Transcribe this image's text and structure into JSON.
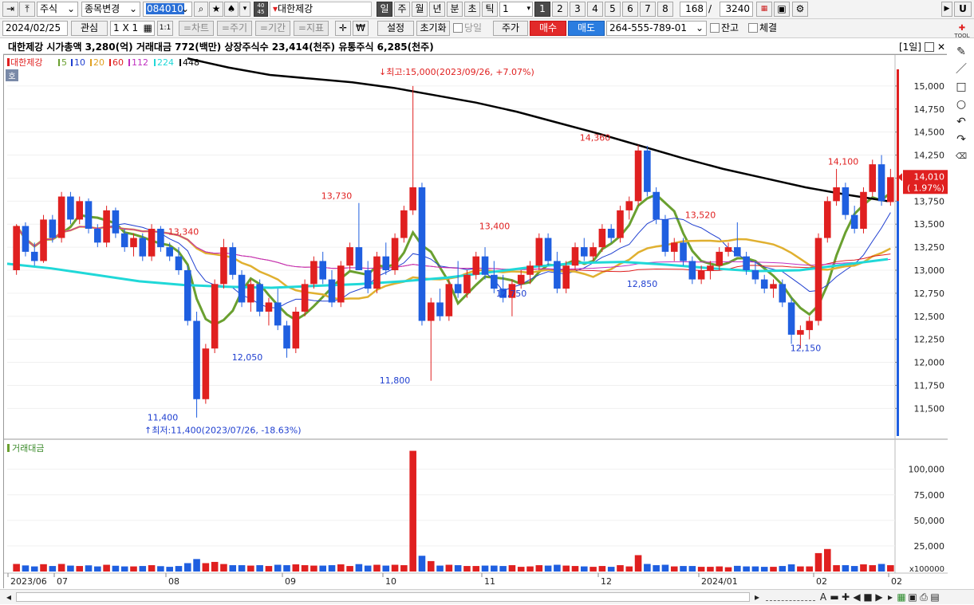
{
  "toolbar1": {
    "market": "주식",
    "change_stock": "종목변경",
    "code": "084010",
    "stock_name": "대한제강",
    "period_buttons": [
      "일",
      "주",
      "월",
      "년",
      "분",
      "초",
      "틱"
    ],
    "period_value": "1",
    "num_buttons": [
      "1",
      "2",
      "3",
      "4",
      "5",
      "6",
      "7",
      "8"
    ],
    "count_value": "168",
    "slash": "/",
    "count_total": "3240",
    "side_badge": "40\n45",
    "right_label": "U"
  },
  "toolbar2": {
    "date": "2024/02/25",
    "interest": "관심",
    "grid": "1 X 1",
    "one_one": "1:1",
    "chart": "=차트",
    "period": "=주기",
    "range": "=기간",
    "indicator": "=지표",
    "settings": "설정",
    "reset": "초기화",
    "today": "당일",
    "price": "주가",
    "buy": "매수",
    "sell": "매도",
    "account": "264-555-789-01",
    "balance": "잔고",
    "fill": "체결",
    "tool_label": "TOOL"
  },
  "infobar": {
    "text": "대한제강  시가총액 3,280(억)  거래대금 772(백만)  상장주식수 23,414(천주)  유통주식 6,285(천주)",
    "layout": "[1일]"
  },
  "price_panel": {
    "legend_name": "대한제강",
    "legend": [
      {
        "label": "5",
        "color": "#6aa030"
      },
      {
        "label": "10",
        "color": "#1f3fd0"
      },
      {
        "label": "20",
        "color": "#e0a020"
      },
      {
        "label": "60",
        "color": "#e02020"
      },
      {
        "label": "112",
        "color": "#c030c0"
      },
      {
        "label": "224",
        "color": "#20d8d8"
      },
      {
        "label": "448",
        "color": "#000000"
      }
    ],
    "ho_badge": "호",
    "y_ticks": [
      "15,000",
      "14,750",
      "14,500",
      "14,250",
      "14,000",
      "13,750",
      "13,500",
      "13,250",
      "13,000",
      "12,750",
      "12,500",
      "12,250",
      "12,000",
      "11,750",
      "11,500"
    ],
    "current_price": "14,010",
    "current_change": "( 1.97%)",
    "high_note": "최고:15,000(2023/09/26, +7.07%)",
    "low_note": "최저:11,400(2023/07/26, -18.63%)",
    "peak_labels": [
      {
        "text": "13,340",
        "color": "#e02020",
        "x": 225,
        "price": 13385
      },
      {
        "text": "13,730",
        "color": "#e02020",
        "x": 417,
        "price": 13775
      },
      {
        "text": "13,400",
        "color": "#e02020",
        "x": 615,
        "price": 13445
      },
      {
        "text": "14,360",
        "color": "#e02020",
        "x": 741,
        "price": 14405
      },
      {
        "text": "13,520",
        "color": "#e02020",
        "x": 873,
        "price": 13565
      },
      {
        "text": "14,100",
        "color": "#e02020",
        "x": 1052,
        "price": 14145
      }
    ],
    "trough_labels": [
      {
        "text": "11,400",
        "color": "#1f3fd0",
        "x": 199,
        "price": 11370
      },
      {
        "text": "12,050",
        "color": "#1f3fd0",
        "x": 305,
        "price": 12020
      },
      {
        "text": "11,800",
        "color": "#1f3fd0",
        "x": 490,
        "price": 11770
      },
      {
        "text": "12,750",
        "color": "#1f3fd0",
        "x": 636,
        "price": 12715
      },
      {
        "text": "12,850",
        "color": "#1f3fd0",
        "x": 800,
        "price": 12820
      },
      {
        "text": "12,150",
        "color": "#1f3fd0",
        "x": 1005,
        "price": 12120
      }
    ]
  },
  "volume_panel": {
    "title": "거래대금",
    "y_ticks": [
      "100,000",
      "75,000",
      "50,000",
      "25,000"
    ],
    "unit": "x100000"
  },
  "x_axis": {
    "labels": [
      "2023/06",
      "07",
      "08",
      "09",
      "10",
      "11",
      "12",
      "2024/01",
      "02",
      "02"
    ]
  },
  "chart_data": {
    "type": "candlestick",
    "title": "대한제강",
    "ylim": [
      11200,
      15250
    ],
    "candles_summary": {
      "high": 15000,
      "high_date": "2023/09/26",
      "low": 11400,
      "low_date": "2023/07/26",
      "last": 14010
    },
    "ohlc": [
      [
        13000,
        13500,
        12950,
        13480
      ],
      [
        13480,
        13520,
        13150,
        13200
      ],
      [
        13200,
        13300,
        13050,
        13100
      ],
      [
        13100,
        13600,
        13080,
        13550
      ],
      [
        13550,
        13600,
        13300,
        13350
      ],
      [
        13350,
        13850,
        13300,
        13800
      ],
      [
        13800,
        13850,
        13500,
        13550
      ],
      [
        13550,
        13800,
        13500,
        13750
      ],
      [
        13750,
        13780,
        13400,
        13450
      ],
      [
        13450,
        13500,
        13250,
        13300
      ],
      [
        13300,
        13700,
        13250,
        13650
      ],
      [
        13650,
        13680,
        13350,
        13400
      ],
      [
        13400,
        13450,
        13200,
        13250
      ],
      [
        13250,
        13400,
        13150,
        13350
      ],
      [
        13350,
        13400,
        13100,
        13150
      ],
      [
        13150,
        13500,
        13100,
        13450
      ],
      [
        13450,
        13480,
        13200,
        13250
      ],
      [
        13250,
        13300,
        13100,
        13150
      ],
      [
        13150,
        13250,
        12950,
        13000
      ],
      [
        13000,
        13050,
        12400,
        12450
      ],
      [
        12450,
        12550,
        11400,
        11600
      ],
      [
        11600,
        12200,
        11550,
        12150
      ],
      [
        12150,
        12900,
        12100,
        12850
      ],
      [
        12850,
        13340,
        12800,
        13250
      ],
      [
        13250,
        13300,
        12900,
        12950
      ],
      [
        12950,
        13000,
        12600,
        12650
      ],
      [
        12650,
        12900,
        12550,
        12850
      ],
      [
        12850,
        12900,
        12500,
        12550
      ],
      [
        12550,
        12700,
        12400,
        12650
      ],
      [
        12650,
        12800,
        12350,
        12400
      ],
      [
        12400,
        12450,
        12050,
        12150
      ],
      [
        12150,
        12600,
        12100,
        12550
      ],
      [
        12550,
        12900,
        12500,
        12850
      ],
      [
        12850,
        13150,
        12800,
        13100
      ],
      [
        13100,
        13200,
        12850,
        12900
      ],
      [
        12900,
        13000,
        12600,
        12650
      ],
      [
        12650,
        13100,
        12600,
        13050
      ],
      [
        13050,
        13300,
        13000,
        13250
      ],
      [
        13250,
        13730,
        13200,
        13000
      ],
      [
        13000,
        13100,
        12750,
        12800
      ],
      [
        12800,
        13200,
        12750,
        13150
      ],
      [
        13150,
        13300,
        12950,
        13000
      ],
      [
        13000,
        13400,
        12950,
        13350
      ],
      [
        13350,
        13700,
        13300,
        13650
      ],
      [
        13650,
        15000,
        13600,
        13900
      ],
      [
        13900,
        13950,
        12400,
        12450
      ],
      [
        12450,
        12700,
        11800,
        12650
      ],
      [
        12650,
        12800,
        12450,
        12500
      ],
      [
        12500,
        12900,
        12450,
        12850
      ],
      [
        12850,
        13100,
        12700,
        12750
      ],
      [
        12750,
        13000,
        12700,
        12950
      ],
      [
        12950,
        13200,
        12900,
        13150
      ],
      [
        13150,
        13250,
        12900,
        12950
      ],
      [
        12950,
        13100,
        12750,
        12800
      ],
      [
        12800,
        12950,
        12650,
        12700
      ],
      [
        12700,
        12900,
        12500,
        12850
      ],
      [
        12850,
        13000,
        12800,
        12950
      ],
      [
        12950,
        13100,
        12850,
        13050
      ],
      [
        13050,
        13400,
        13000,
        13350
      ],
      [
        13350,
        13400,
        13050,
        13100
      ],
      [
        13100,
        13200,
        12750,
        12800
      ],
      [
        12800,
        13100,
        12750,
        13050
      ],
      [
        13050,
        13300,
        13000,
        13250
      ],
      [
        13250,
        13350,
        13100,
        13150
      ],
      [
        13150,
        13300,
        13100,
        13250
      ],
      [
        13250,
        13500,
        13200,
        13450
      ],
      [
        13450,
        13500,
        13300,
        13350
      ],
      [
        13350,
        13700,
        13300,
        13650
      ],
      [
        13650,
        13800,
        13550,
        13750
      ],
      [
        13750,
        14360,
        13700,
        14300
      ],
      [
        14300,
        14350,
        13800,
        13850
      ],
      [
        13850,
        13900,
        13500,
        13550
      ],
      [
        13550,
        13600,
        13150,
        13200
      ],
      [
        13200,
        13350,
        13100,
        13300
      ],
      [
        13300,
        13350,
        13050,
        13100
      ],
      [
        13100,
        13150,
        12850,
        12900
      ],
      [
        12900,
        13050,
        12850,
        13000
      ],
      [
        13000,
        13100,
        12900,
        13050
      ],
      [
        13050,
        13250,
        13000,
        13200
      ],
      [
        13200,
        13300,
        13150,
        13250
      ],
      [
        13250,
        13520,
        13200,
        13150
      ],
      [
        13150,
        13200,
        12950,
        13000
      ],
      [
        13000,
        13100,
        12850,
        12900
      ],
      [
        12900,
        12950,
        12750,
        12800
      ],
      [
        12800,
        12900,
        12700,
        12850
      ],
      [
        12850,
        12900,
        12600,
        12650
      ],
      [
        12650,
        12700,
        12200,
        12300
      ],
      [
        12300,
        12400,
        12150,
        12350
      ],
      [
        12350,
        12500,
        12250,
        12450
      ],
      [
        12450,
        13400,
        12400,
        13350
      ],
      [
        13350,
        13800,
        13300,
        13750
      ],
      [
        13750,
        14100,
        13700,
        13900
      ],
      [
        13900,
        13950,
        13550,
        13600
      ],
      [
        13600,
        13700,
        13400,
        13450
      ],
      [
        13450,
        13900,
        13400,
        13850
      ],
      [
        13850,
        14200,
        13800,
        14150
      ],
      [
        14150,
        14250,
        13700,
        13750
      ],
      [
        13740,
        14100,
        13700,
        14010
      ]
    ]
  }
}
